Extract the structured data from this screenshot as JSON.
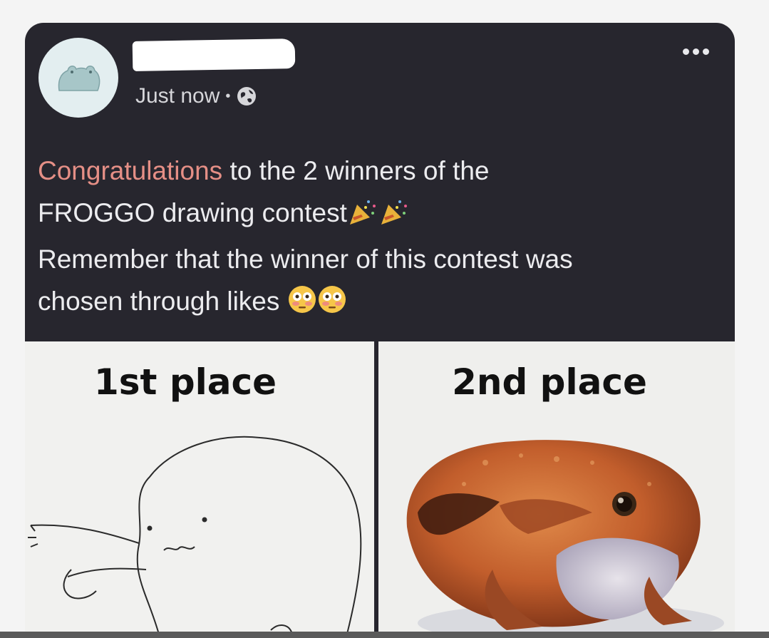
{
  "post": {
    "timestamp": "Just now",
    "separator": "•",
    "privacy_icon": "globe-icon",
    "more_icon": "more-horizontal-icon",
    "text": {
      "highlight": "Congratulations",
      "line1_rest": " to the 2 winners of the",
      "line2": "FROGGO drawing contest",
      "line3": "Remember that the winner of this contest was",
      "line4": "chosen through likes"
    },
    "emojis": {
      "party": "party-popper-icon",
      "flushed": "flushed-face-icon"
    }
  },
  "images": {
    "first": {
      "label": "1st place"
    },
    "second": {
      "label": "2nd place"
    }
  },
  "colors": {
    "card_bg": "#27262e",
    "highlight": "#e58f86",
    "text": "#ececef"
  }
}
